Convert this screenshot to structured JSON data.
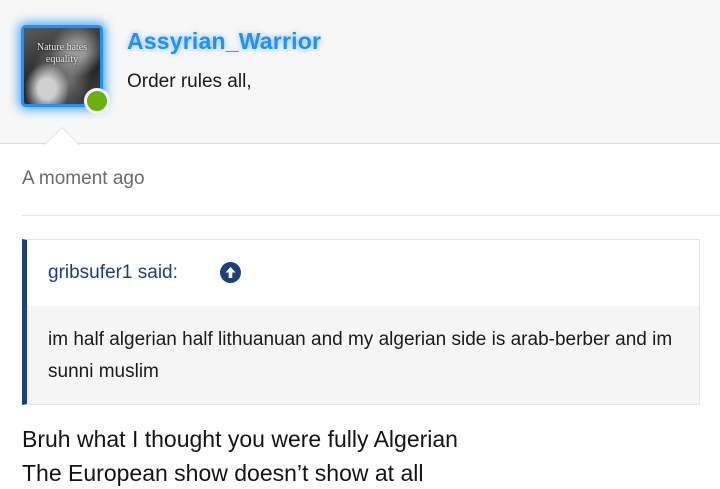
{
  "post": {
    "author": {
      "username": "Assyrian_Warrior",
      "user_title": "Order rules all,",
      "avatar_text": "Nature hates equality",
      "status": "online",
      "username_color": "#1e90ff",
      "online_color": "#6cb010"
    },
    "timestamp": "A moment ago",
    "quote": {
      "author_line": "gribsufer1 said:",
      "jump_icon": "arrow-up-circle-icon",
      "text": "im half algerian half lithuanuan and my algerian side is arab-berber and im sunni muslim",
      "accent_color": "#1f3f7a"
    },
    "reply_lines": [
      "Bruh what I thought you were fully Algerian",
      "The European show doesn’t show at all"
    ]
  }
}
